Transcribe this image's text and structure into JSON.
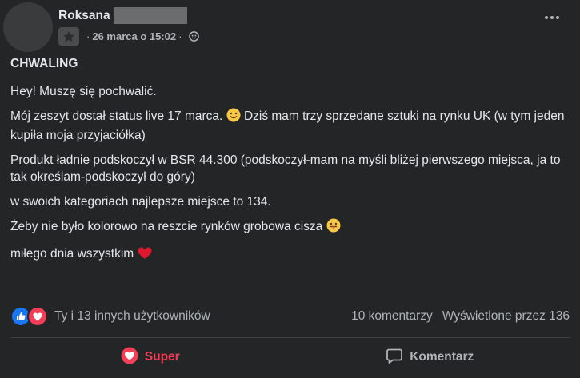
{
  "post": {
    "author_name": "Roksana",
    "date": "26 marca o 15:02",
    "separator": "·",
    "title": "CHWALING",
    "paragraphs": [
      {
        "text": "Hey! Muszę się pochwalić.",
        "emoji": ""
      },
      {
        "text_before": "Mój zeszyt dostał status live 17 marca. ",
        "emoji": "smile-emoji",
        "text_after": " Dziś mam trzy sprzedane sztuki na rynku UK (w tym jeden kupiła moja przyjaciółka)"
      },
      {
        "text": "Produkt ładnie podskoczył w BSR 44.300 (podskoczył-mam na myśli bliżej pierwszego miejsca, ja to tak określam-podskoczył do góry)"
      },
      {
        "text": "w swoich kategoriach najlepsze miejsce to 134."
      },
      {
        "text": "Żeby nie było kolorowo na reszcie rynków grobowa cisza ",
        "emoji": "tongue-emoji"
      },
      {
        "text": "miłego dnia wszystkim ",
        "emoji": "red-heart-emoji"
      }
    ]
  },
  "reactions": {
    "icons": [
      "like-reaction-icon",
      "love-reaction-icon"
    ],
    "summary": "Ty i 13 innych użytkowników",
    "comments": "10 komentarzy",
    "views": "Wyświetlone przez 136"
  },
  "actions": {
    "super_label": "Super",
    "comment_label": "Komentarz"
  },
  "colors": {
    "background": "#242526",
    "text": "#e4e6eb",
    "secondary": "#b0b3b8",
    "like_blue": "#1877f2",
    "love_red": "#f33e58"
  }
}
